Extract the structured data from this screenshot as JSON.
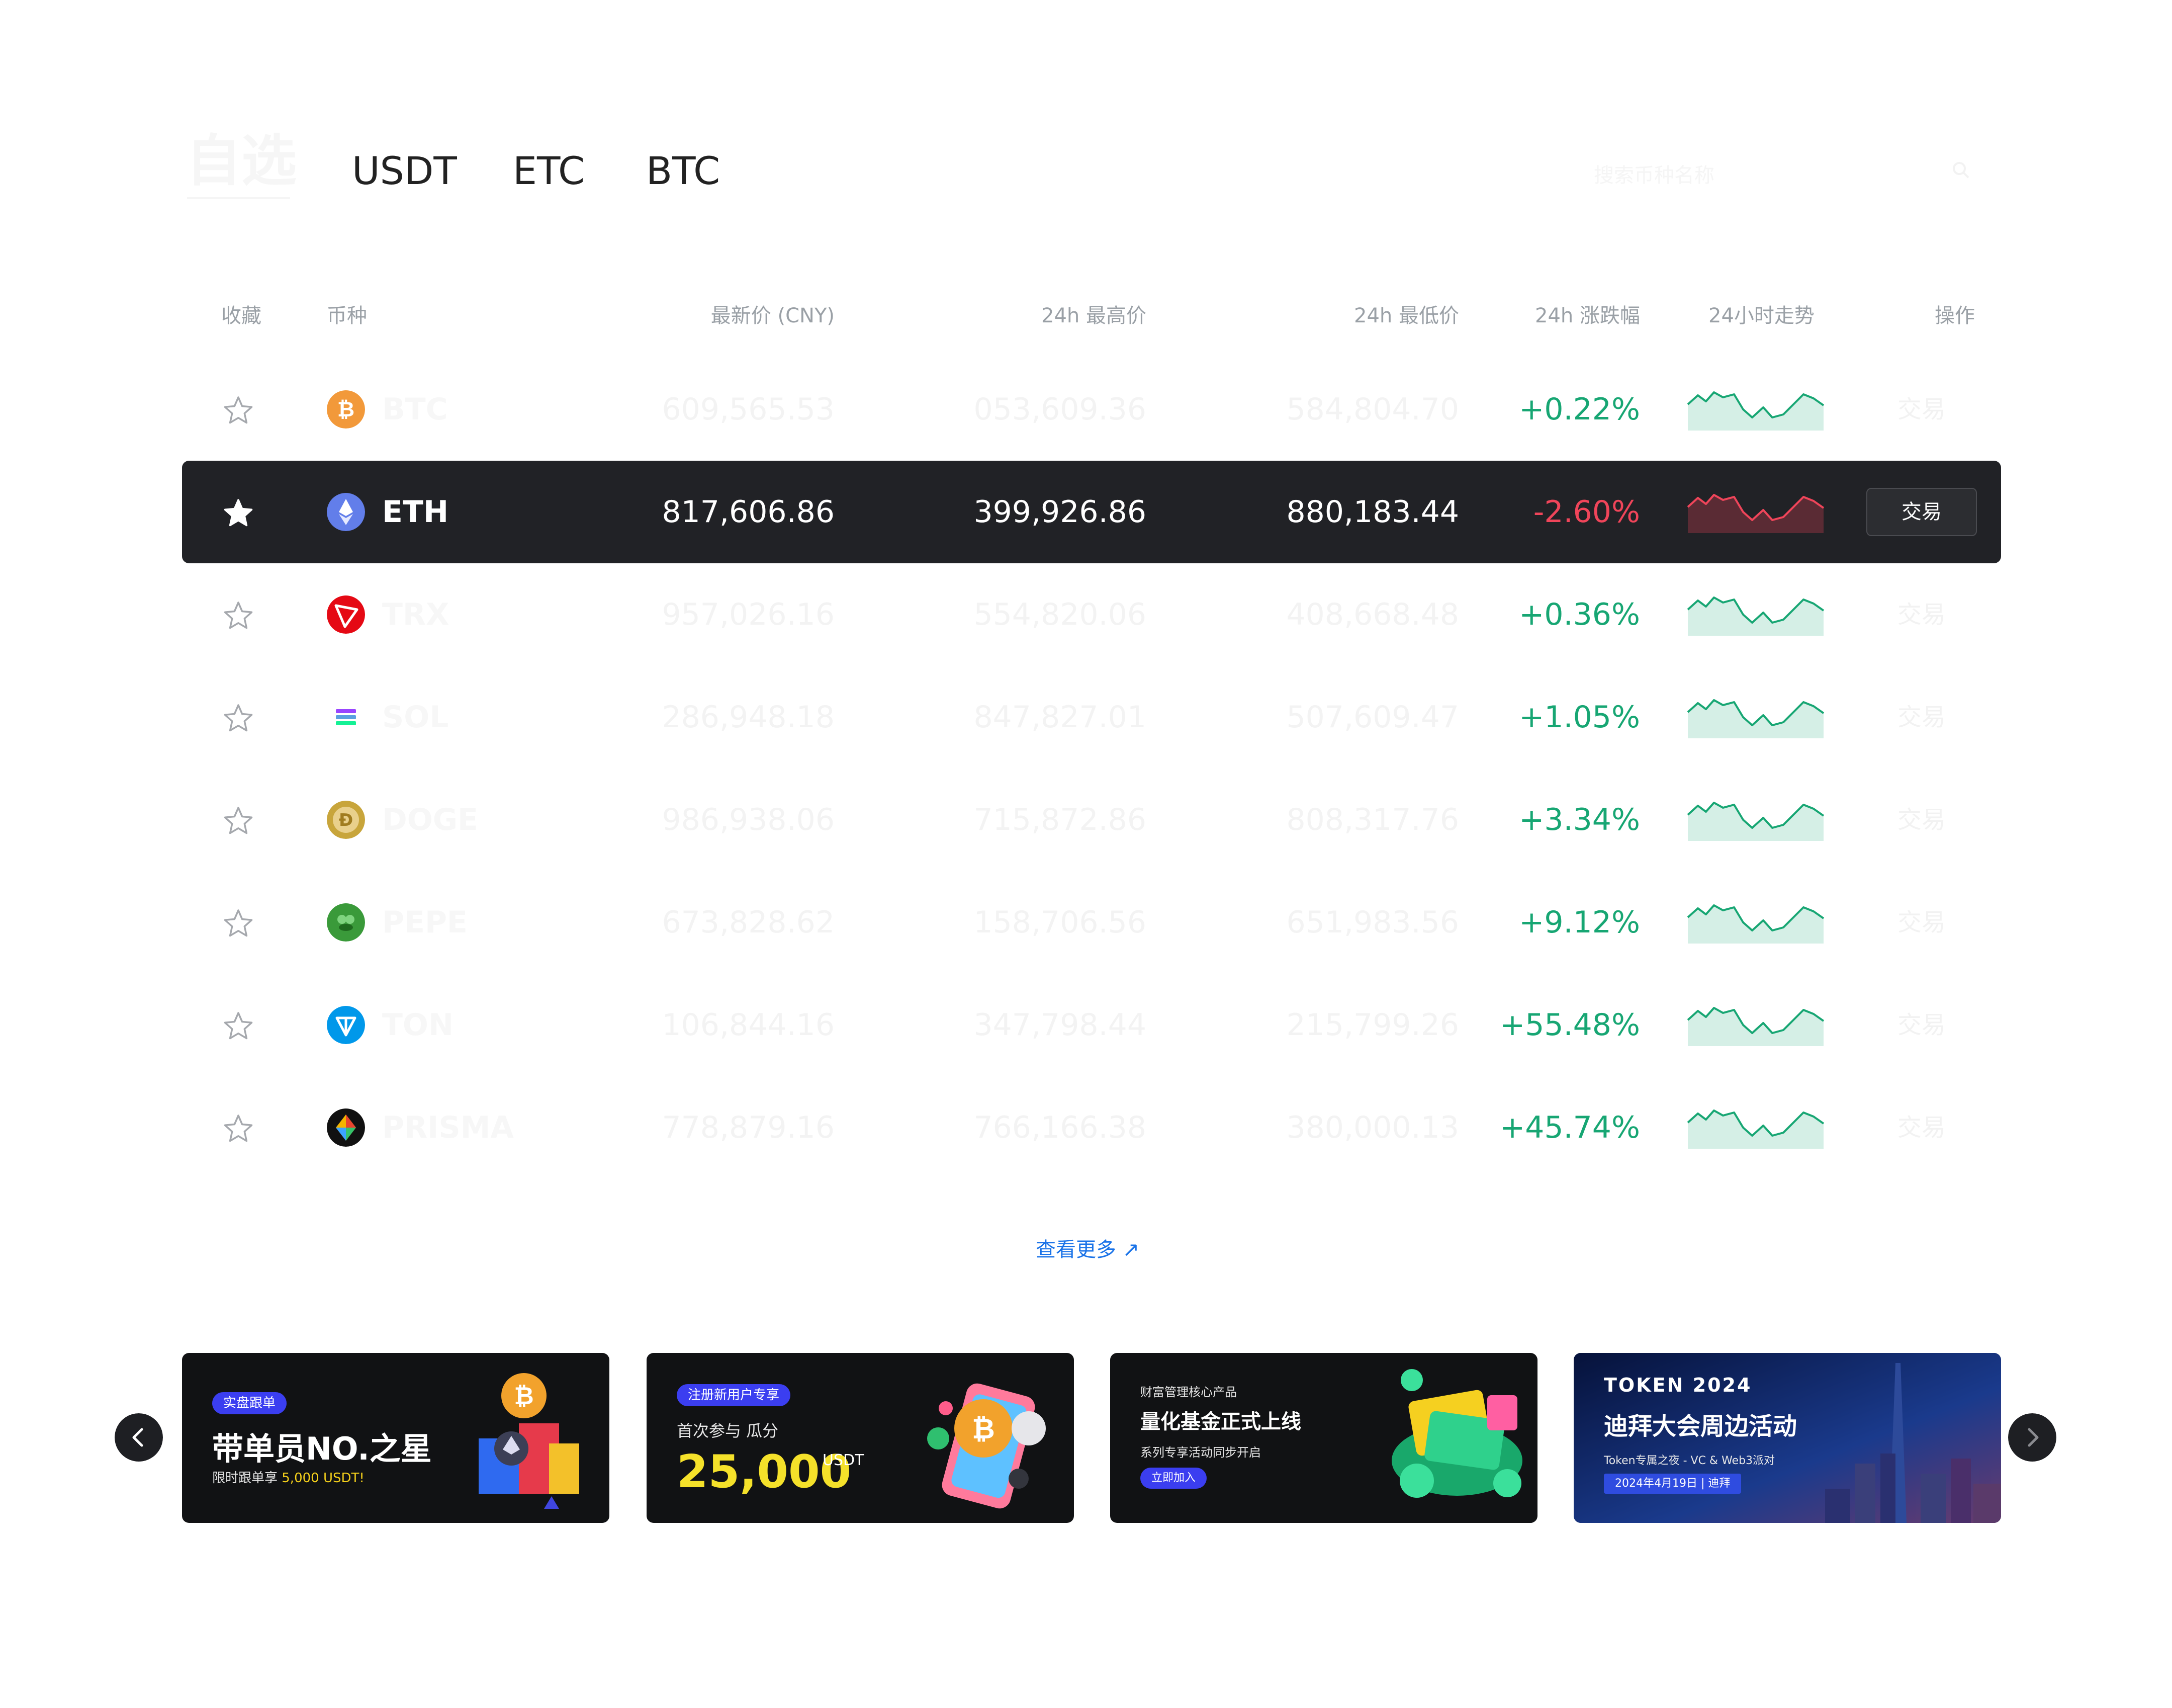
{
  "tabs": [
    {
      "label": "自选"
    },
    {
      "label": "USDT"
    },
    {
      "label": "ETC"
    },
    {
      "label": "BTC"
    }
  ],
  "search": {
    "placeholder": "搜索币种名称"
  },
  "table": {
    "headers": {
      "fav": "收藏",
      "coin": "币种",
      "price": "最新价 (CNY)",
      "high": "24h 最高价",
      "low": "24h 最低价",
      "change": "24h 涨跌幅",
      "trend": "24小时走势",
      "action": "操作"
    },
    "rows": [
      {
        "symbol": "BTC",
        "price": "609,565.53",
        "high": "053,609.36",
        "low": "584,804.70",
        "change": "+0.22%",
        "direction": "up",
        "favorited": false,
        "action": "交易"
      },
      {
        "symbol": "ETH",
        "price": "817,606.86",
        "high": "399,926.86",
        "low": "880,183.44",
        "change": "-2.60%",
        "direction": "down",
        "favorited": true,
        "action": "交易"
      },
      {
        "symbol": "TRX",
        "price": "957,026.16",
        "high": "554,820.06",
        "low": "408,668.48",
        "change": "+0.36%",
        "direction": "up",
        "favorited": false,
        "action": "交易"
      },
      {
        "symbol": "SOL",
        "price": "286,948.18",
        "high": "847,827.01",
        "low": "507,609.47",
        "change": "+1.05%",
        "direction": "up",
        "favorited": false,
        "action": "交易"
      },
      {
        "symbol": "DOGE",
        "price": "986,938.06",
        "high": "715,872.86",
        "low": "808,317.76",
        "change": "+3.34%",
        "direction": "up",
        "favorited": false,
        "action": "交易"
      },
      {
        "symbol": "PEPE",
        "price": "673,828.62",
        "high": "158,706.56",
        "low": "651,983.56",
        "change": "+9.12%",
        "direction": "up",
        "favorited": false,
        "action": "交易"
      },
      {
        "symbol": "TON",
        "price": "106,844.16",
        "high": "347,798.44",
        "low": "215,799.26",
        "change": "+55.48%",
        "direction": "up",
        "favorited": false,
        "action": "交易"
      },
      {
        "symbol": "PRISMA",
        "price": "778,879.16",
        "high": "766,166.38",
        "low": "380,000.13",
        "change": "+45.74%",
        "direction": "up",
        "favorited": false,
        "action": "交易"
      }
    ]
  },
  "view_more": "查看更多 ↗",
  "colors": {
    "up": "#17a673",
    "down": "#f0455a",
    "accent": "#1a73e8"
  },
  "banners": [
    {
      "tag": "实盘跟单",
      "title": "带单员NO.之星",
      "sub_prefix": "限时跟单享 ",
      "sub_highlight": "5,000 USDT!"
    },
    {
      "tag": "注册新用户专享",
      "line1": "首次参与 瓜分",
      "amount": "25,000",
      "unit": "USDT"
    },
    {
      "kicker": "财富管理核心产品",
      "title": "量化基金正式上线",
      "sub": "系列专享活动同步开启",
      "button": "立即加入"
    },
    {
      "brand": "TOKEN 2024",
      "title": "迪拜大会周边活动",
      "sub": "Token专属之夜 - VC & Web3派对",
      "date": "2024年4月19日 | 迪拜"
    }
  ]
}
